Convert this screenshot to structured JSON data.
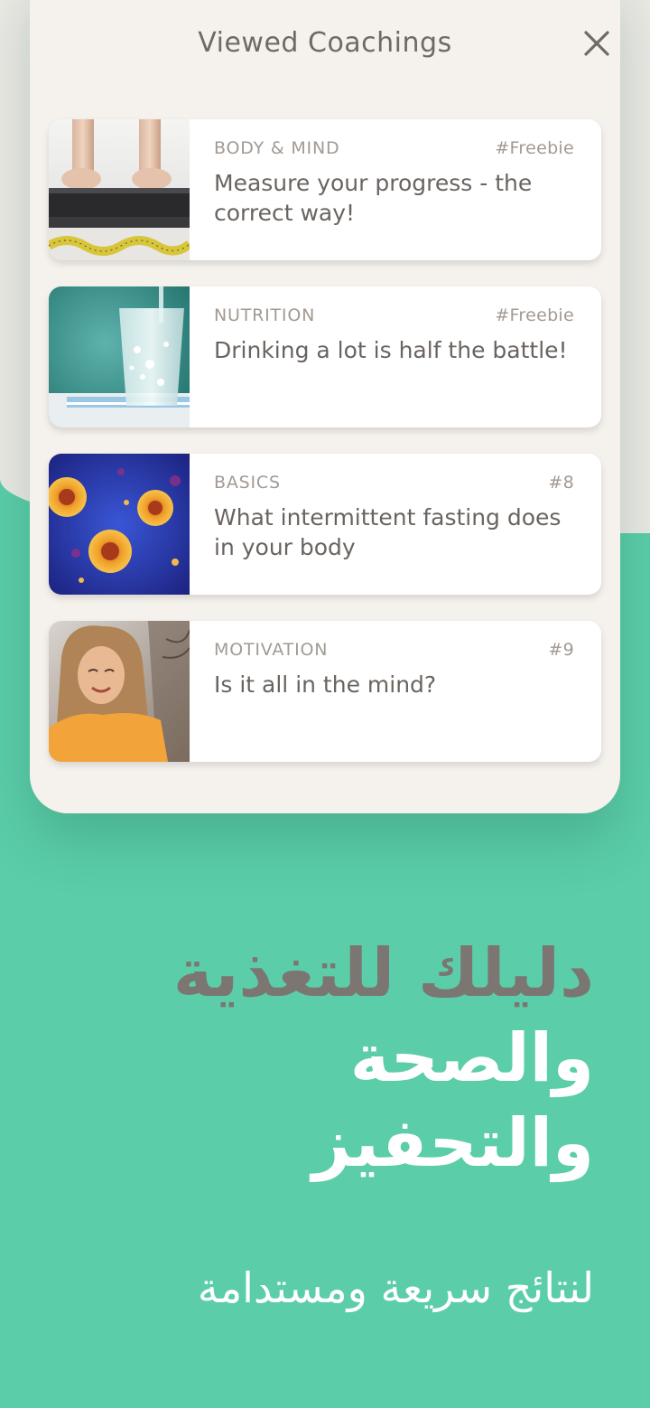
{
  "panel": {
    "title": "Viewed Coachings",
    "close_icon": "close-icon"
  },
  "cards": [
    {
      "category": "BODY & MIND",
      "tag": "#Freebie",
      "title": "Measure your progress - the correct way!",
      "thumbnail": "scale-and-tape-measure-photo"
    },
    {
      "category": "NUTRITION",
      "tag": "#Freebie",
      "title": "Drinking a lot is half the battle!",
      "thumbnail": "glass-of-water-photo"
    },
    {
      "category": "BASICS",
      "tag": "#8",
      "title": "What intermittent fasting does in your body",
      "thumbnail": "cells-microscope-photo"
    },
    {
      "category": "MOTIVATION",
      "tag": "#9",
      "title": "Is it all in the mind?",
      "thumbnail": "smiling-woman-photo"
    }
  ],
  "headline": {
    "line1": "دليلك للتغذية",
    "line2": "والصحة",
    "line3": "والتحفيز"
  },
  "subheadline": "لنتائج سريعة ومستدامة",
  "colors": {
    "background_green": "#5bcda9",
    "panel": "#f5f1ec",
    "top_background": "#ebe9e4",
    "headline_grey": "#7b7672",
    "text_white": "#ffffff"
  }
}
